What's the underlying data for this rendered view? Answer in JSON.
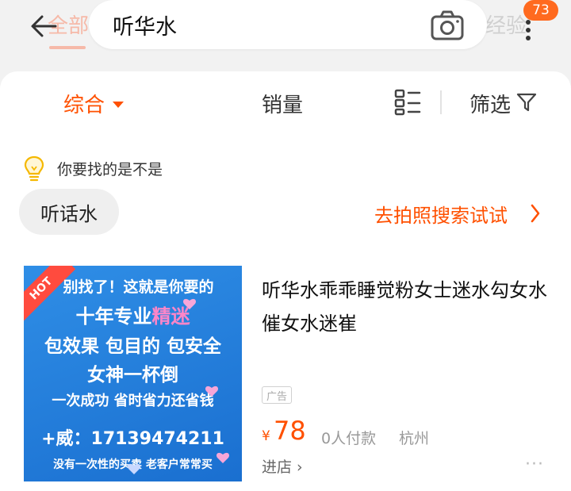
{
  "header": {
    "back_icon": "arrow-left-icon",
    "bg_tab_left": "全部",
    "bg_tab_right": "经验",
    "search_query": "听华水",
    "camera_icon": "camera-icon",
    "more_icon": "more-vertical-icon",
    "notification_count": "73"
  },
  "sort_bar": {
    "items": [
      {
        "label": "综合",
        "active": true
      },
      {
        "label": "销量",
        "active": false
      }
    ],
    "layout_icon": "grid-list-icon",
    "filter_label": "筛选",
    "filter_icon": "funnel-icon"
  },
  "suggestion": {
    "bulb_icon": "lightbulb-icon",
    "title": "你要找的是不是",
    "chip": "听话水",
    "photo_search": "去拍照搜索试试"
  },
  "product": {
    "image": {
      "hot": "HOT",
      "line1": "别找了！这就是你要的",
      "line2a": "十年专业",
      "line2b": "精迷",
      "line3": "包效果 包目的 包安全",
      "line4": "女神一杯倒",
      "line5": "一次成功 省时省力还省钱",
      "line6": "+威：17139474211",
      "line7": "没有一次性的买卖 老客户常常买"
    },
    "title": "听华水乖乖睡觉粉女士迷水勾女水催女水迷崔",
    "ad_tag": "广告",
    "currency": "¥",
    "price": "78",
    "sold": "0人付款",
    "city": "杭州",
    "shop_link": "进店 ›",
    "more": "···"
  },
  "colors": {
    "accent": "#ff5000",
    "badge": "#ff6a1f",
    "image_bg": "#2f8ee6"
  }
}
